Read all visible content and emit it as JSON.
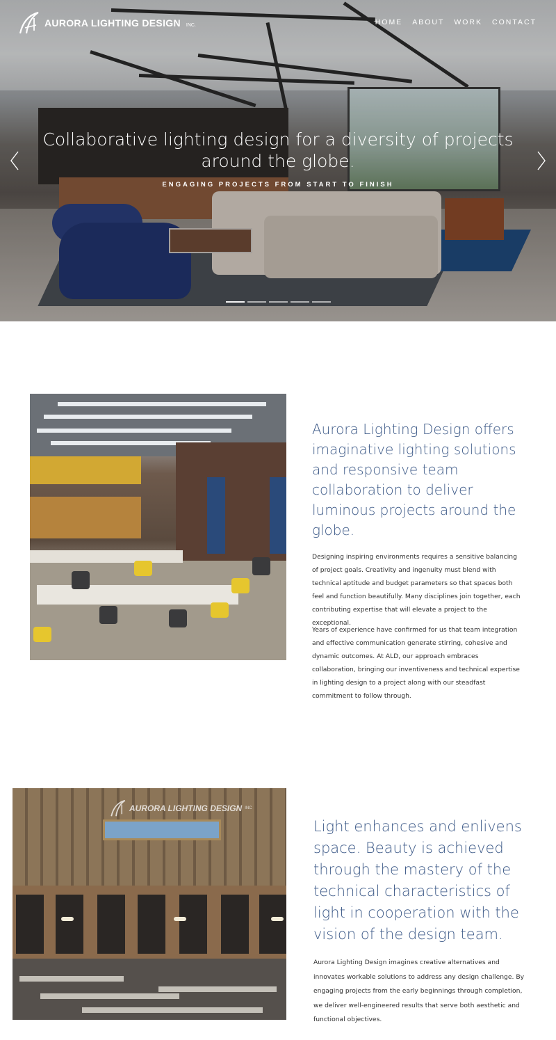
{
  "brand": {
    "name": "AURORA LIGHTING DESIGN",
    "suffix": "INC."
  },
  "nav": {
    "items": [
      "HOME",
      "ABOUT",
      "WORK",
      "CONTACT"
    ]
  },
  "hero": {
    "headline": "Collaborative lighting design for a diversity of projects around the globe.",
    "subheadline": "ENGAGING PROJECTS FROM START TO FINISH",
    "slide_count": 5,
    "active_slide": 1
  },
  "section1": {
    "heading": "Aurora Lighting Design offers imaginative lighting solutions and responsive team collaboration to deliver luminous projects around the globe.",
    "paragraph1": "Designing inspiring environments requires a sensitive balancing of project goals. Creativity and ingenuity must blend with technical aptitude and budget parameters so that spaces both feel and function beautifully. Many disciplines join together, each contributing expertise that will elevate a project to the exceptional.",
    "paragraph2": "Years of experience have confirmed for us that team integration and effective communication generate stirring, cohesive and dynamic outcomes. At ALD, our approach embraces collaboration, bringing our inventiveness and technical expertise in lighting design to a project along with our steadfast commitment to follow through."
  },
  "section2": {
    "watermark": "AURORA LIGHTING DESIGN",
    "watermark_suffix": "INC",
    "heading": "Light enhances and enlivens space. Beauty is achieved through the mastery of the technical characteristics of light in cooperation with the vision of the design team.",
    "paragraph1": "Aurora Lighting Design imagines creative alternatives and innovates workable solutions to address any design challenge. By engaging projects from the early beginnings through completion, we deliver well-engineered results that serve both aesthetic and functional objectives."
  },
  "colors": {
    "accent": "#3d5a88",
    "body_text": "#333333",
    "background": "#ffffff",
    "nav_text": "#ffffff"
  },
  "icons": {
    "logo": "aurora-logo-icon",
    "prev": "chevron-left-icon",
    "next": "chevron-right-icon"
  }
}
